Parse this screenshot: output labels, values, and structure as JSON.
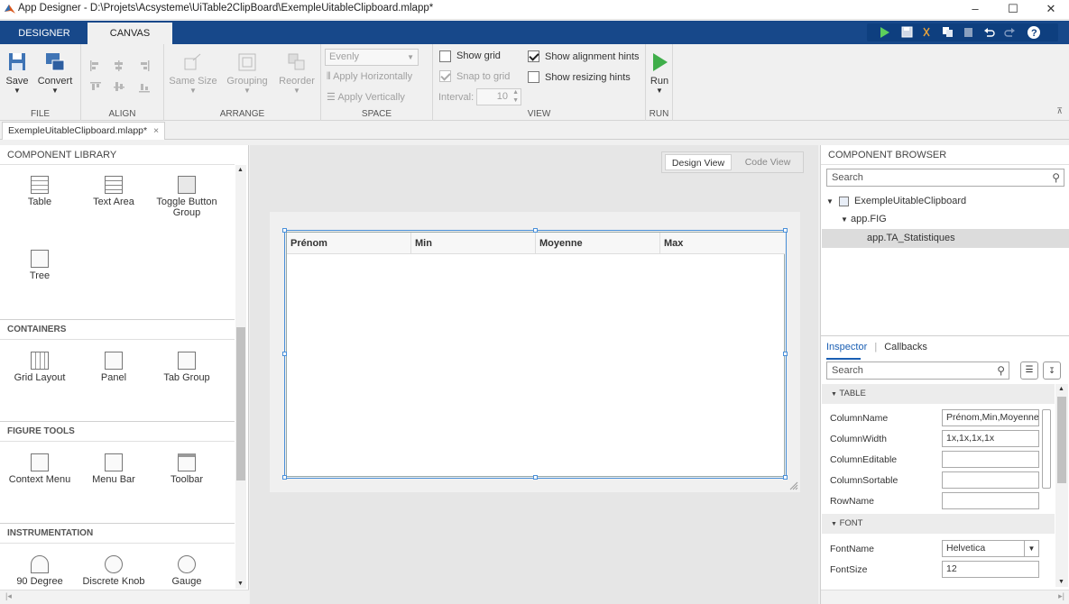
{
  "window": {
    "title": "App Designer - D:\\Projets\\Acsysteme\\UiTable2ClipBoard\\ExempleUitableClipboard.mlapp*",
    "minimize": "–",
    "maximize": "☐",
    "close": "✕"
  },
  "tabs": {
    "designer": "DESIGNER",
    "canvas": "CANVAS"
  },
  "ribbon": {
    "file": {
      "title": "FILE",
      "save": "Save",
      "convert": "Convert"
    },
    "align": {
      "title": "ALIGN"
    },
    "arrange": {
      "title": "ARRANGE",
      "same_size": "Same Size",
      "grouping": "Grouping",
      "reorder": "Reorder"
    },
    "space": {
      "title": "SPACE",
      "select_value": "Evenly",
      "apply_h": "Apply Horizontally",
      "apply_v": "Apply Vertically"
    },
    "view": {
      "title": "VIEW",
      "show_grid": "Show grid",
      "snap_to_grid": "Snap to grid",
      "interval_label": "Interval:",
      "interval_value": "10",
      "show_alignment": "Show alignment hints",
      "show_resizing": "Show resizing hints"
    },
    "run": {
      "title": "RUN",
      "run": "Run"
    }
  },
  "document_tab": {
    "label": "ExempleUitableClipboard.mlapp*",
    "close": "×"
  },
  "library": {
    "header": "COMPONENT LIBRARY",
    "sections": {
      "containers": "CONTAINERS",
      "figure_tools": "FIGURE TOOLS",
      "instrumentation": "INSTRUMENTATION"
    },
    "items": {
      "table": "Table",
      "text_area": "Text Area",
      "toggle_button_group": "Toggle Button Group",
      "tree": "Tree",
      "grid_layout": "Grid Layout",
      "panel": "Panel",
      "tab_group": "Tab Group",
      "context_menu": "Context Menu",
      "menu_bar": "Menu Bar",
      "toolbar": "Toolbar",
      "degree90": "90 Degree",
      "discrete_knob": "Discrete Knob",
      "gauge": "Gauge"
    }
  },
  "view_toggle": {
    "design": "Design View",
    "code": "Code View"
  },
  "table": {
    "columns": [
      "Prénom",
      "Min",
      "Moyenne",
      "Max"
    ]
  },
  "browser": {
    "header": "COMPONENT BROWSER",
    "search_placeholder": "Search",
    "tree": {
      "root": "ExempleUitableClipboard",
      "figure": "app.FIG",
      "table": "app.TA_Statistiques"
    }
  },
  "inspector": {
    "tab_inspector": "Inspector",
    "tab_callbacks": "Callbacks",
    "separator": "|",
    "search_placeholder": "Search",
    "group_table": "TABLE",
    "group_font": "FONT",
    "props": {
      "column_name": {
        "label": "ColumnName",
        "value": "Prénom,Min,Moyenne"
      },
      "column_width": {
        "label": "ColumnWidth",
        "value": "1x,1x,1x,1x"
      },
      "column_editable": {
        "label": "ColumnEditable",
        "value": ""
      },
      "column_sortable": {
        "label": "ColumnSortable",
        "value": ""
      },
      "row_name": {
        "label": "RowName",
        "value": ""
      },
      "font_name": {
        "label": "FontName",
        "value": "Helvetica"
      },
      "font_size": {
        "label": "FontSize",
        "value": "12"
      }
    }
  },
  "colors": {
    "tabbar": "#17488a",
    "selection": "#4a90d9",
    "run_green": "#3fae4a"
  }
}
